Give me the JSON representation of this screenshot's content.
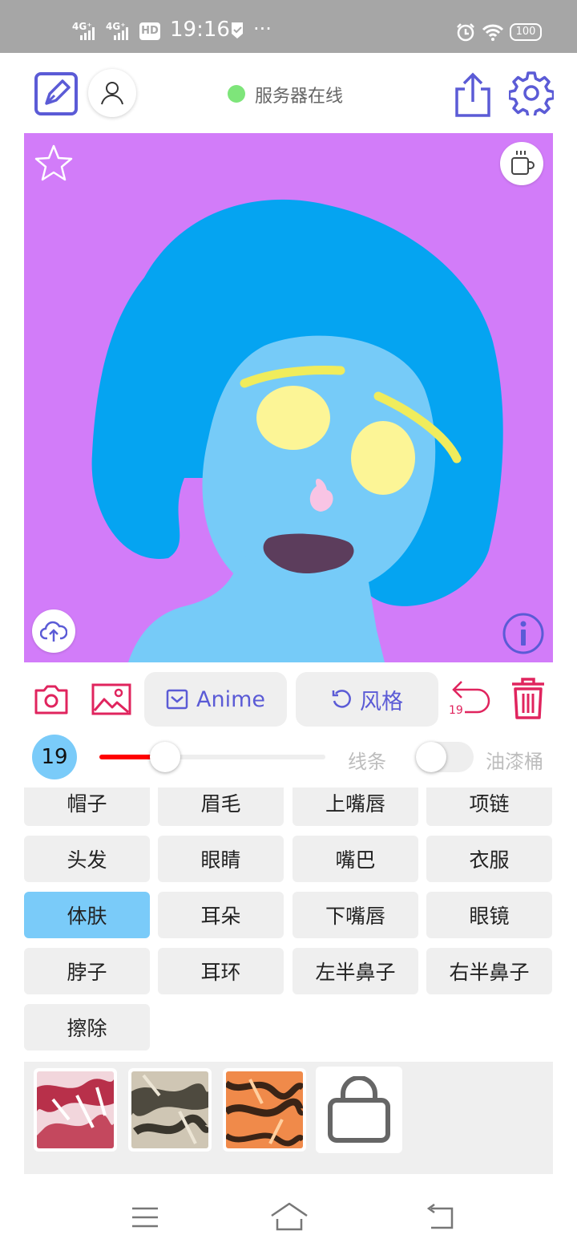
{
  "status_bar": {
    "signal1": "4G⁺",
    "signal2": "4G⁺",
    "hd_label": "HD",
    "time": "19:16",
    "more": "···",
    "battery": "100"
  },
  "toolbar": {
    "server_status": "服务器在线",
    "status_color": "#7ee57a"
  },
  "canvas": {
    "background": "#d27cf9"
  },
  "actions": {
    "anime_label": "Anime",
    "style_label": "风格",
    "undo_count": "19"
  },
  "brush": {
    "size": "19",
    "size_fraction": 0.29,
    "line_label": "线条",
    "bucket_label": "油漆桶",
    "bucket_on": false
  },
  "categories": [
    {
      "label": "帽子"
    },
    {
      "label": "眉毛"
    },
    {
      "label": "上嘴唇"
    },
    {
      "label": "项链"
    },
    {
      "label": "头发"
    },
    {
      "label": "眼睛"
    },
    {
      "label": "嘴巴"
    },
    {
      "label": "衣服"
    },
    {
      "label": "体肤",
      "active": true
    },
    {
      "label": "耳朵"
    },
    {
      "label": "下嘴唇"
    },
    {
      "label": "眼镜"
    },
    {
      "label": "脖子"
    },
    {
      "label": "耳环"
    },
    {
      "label": "左半鼻子"
    },
    {
      "label": "右半鼻子"
    },
    {
      "label": "擦除"
    }
  ],
  "colors": {
    "accent_purple": "#5b5bd6",
    "accent_red": "#e0245e",
    "active_blue": "#7acbf9"
  }
}
